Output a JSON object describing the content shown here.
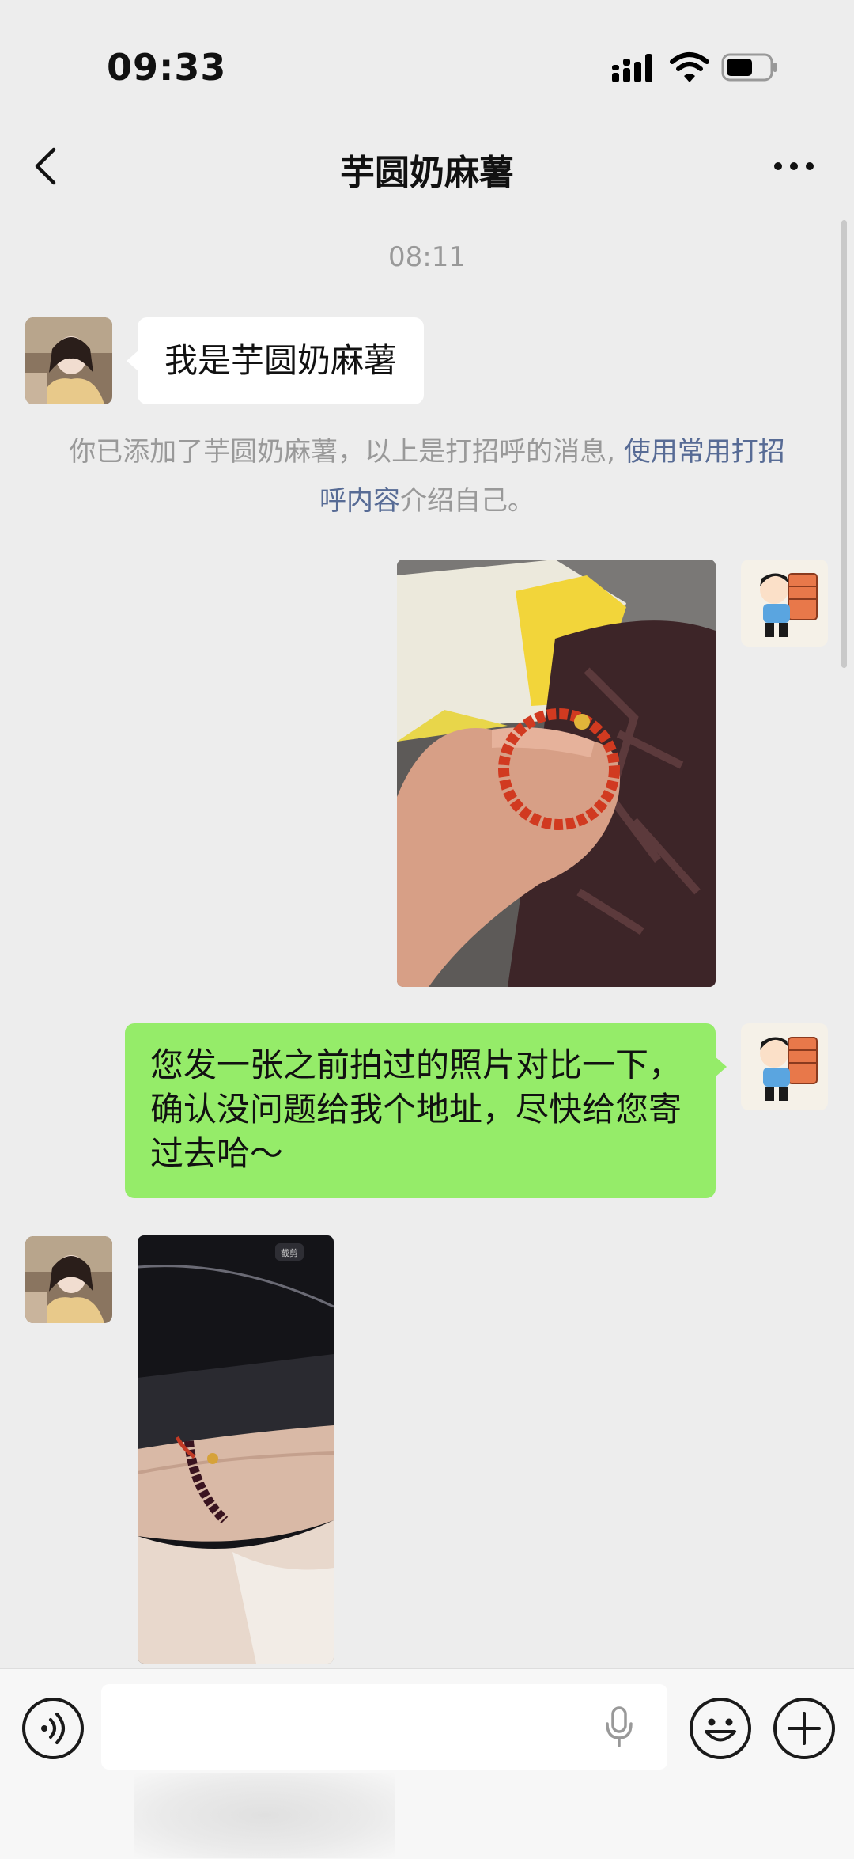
{
  "status_bar": {
    "time": "09:33"
  },
  "nav": {
    "title": "芋圆奶麻薯"
  },
  "chat": {
    "timestamp": "08:11",
    "greeting_message": "我是芋圆奶麻薯",
    "notice": {
      "before": "你已添加了芋圆奶麻薯，以上是打招呼的消息, ",
      "link": "使用常用打招呼内容",
      "after": "介绍自己。"
    },
    "sent_message": "您发一张之前拍过的照片对比一下，确认没问题给我个地址，尽快给您寄过去哈～",
    "photo_label": "截剪"
  },
  "input_bar": {
    "placeholder": ""
  },
  "icons": [
    "back-icon",
    "more-icon",
    "voice-toggle-icon",
    "microphone-icon",
    "emoji-icon",
    "plus-icon",
    "signal-icon",
    "wifi-icon",
    "battery-icon"
  ],
  "colors": {
    "background": "#ededed",
    "sent_bubble": "#95ec69",
    "received_bubble": "#ffffff",
    "link": "#576b95"
  }
}
